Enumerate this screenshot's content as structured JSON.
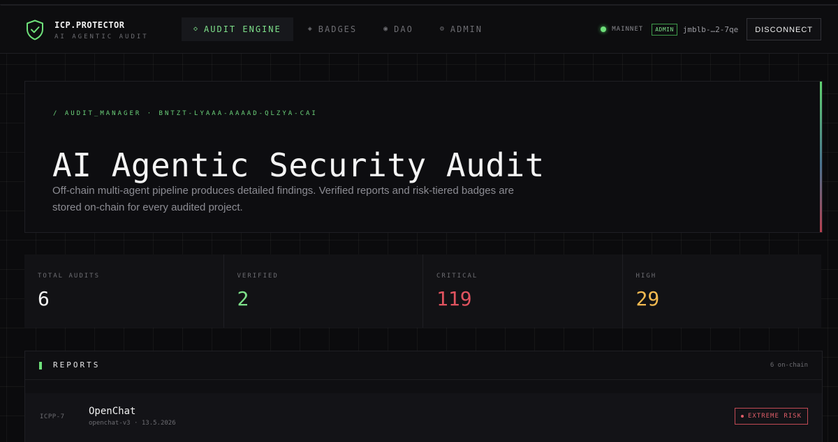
{
  "brand": {
    "title": "ICP.PROTECTOR",
    "subtitle": "AI AGENTIC AUDIT",
    "icon": "shield-check-icon"
  },
  "nav": {
    "items": [
      {
        "glyph": "◇",
        "label": "AUDIT ENGINE",
        "active": true
      },
      {
        "glyph": "◈",
        "label": "BADGES",
        "active": false
      },
      {
        "glyph": "◉",
        "label": "DAO",
        "active": false
      },
      {
        "glyph": "⚙",
        "label": "ADMIN",
        "active": false
      }
    ]
  },
  "status": {
    "network": "MAINNET",
    "role": "ADMIN",
    "principal": "jmblb-…2-7qe",
    "disconnect_label": "DISCONNECT"
  },
  "hero": {
    "breadcrumb": "/ AUDIT_MANAGER · BNTZT-LYAAA-AAAAD-QLZYA-CAI",
    "title": "AI Agentic Security Audit",
    "description": "Off-chain multi-agent pipeline produces detailed findings. Verified reports and risk-tiered badges are stored on-chain for every audited project."
  },
  "stats": [
    {
      "label": "TOTAL AUDITS",
      "value": "6",
      "color": "#f2f2f2"
    },
    {
      "label": "VERIFIED",
      "value": "2",
      "color": "#7ee08a"
    },
    {
      "label": "CRITICAL",
      "value": "119",
      "color": "#e0535f"
    },
    {
      "label": "HIGH",
      "value": "29",
      "color": "#f2b950"
    }
  ],
  "reports": {
    "title": "REPORTS",
    "count": "6 on-chain",
    "rows": [
      {
        "id": "ICPP-7",
        "name": "OpenChat",
        "meta": "openchat-v3 · 13.5.2026",
        "risk": "EXTREME RISK"
      }
    ]
  },
  "colors": {
    "accent_green": "#6ee07a",
    "danger": "#e05d68",
    "warning": "#f2b950"
  }
}
